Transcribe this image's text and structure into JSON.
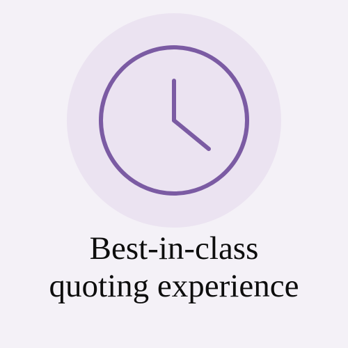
{
  "icon": {
    "name": "clock-icon",
    "accent_color": "#7b5ba3",
    "badge_color": "#ebe3f1"
  },
  "caption": {
    "line1": "Best-in-class",
    "line2": "quoting experience"
  }
}
